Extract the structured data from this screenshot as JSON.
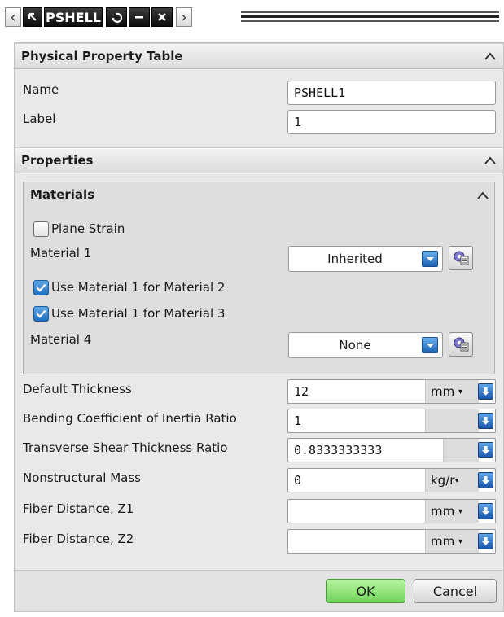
{
  "toolbar": {
    "title": "PSHELL",
    "nav_left_icon": "chevron-left-icon",
    "nav_right_icon": "chevron-right-icon",
    "select_icon": "arrow-select-icon",
    "undo_icon": "undo-icon",
    "minimize_icon": "minimize-icon",
    "close_icon": "close-icon"
  },
  "physical_property_table": {
    "header": "Physical Property Table",
    "name_label": "Name",
    "name_value": "PSHELL1",
    "label_label": "Label",
    "label_value": "1"
  },
  "properties": {
    "header": "Properties",
    "materials": {
      "header": "Materials",
      "plane_strain_label": "Plane Strain",
      "plane_strain_checked": false,
      "material1_label": "Material 1",
      "material1_value": "Inherited",
      "use_mat1_for_mat2_label": "Use Material 1 for Material 2",
      "use_mat1_for_mat2_checked": true,
      "use_mat1_for_mat3_label": "Use Material 1 for Material 3",
      "use_mat1_for_mat3_checked": true,
      "material4_label": "Material 4",
      "material4_value": "None"
    },
    "rows": [
      {
        "label": "Default Thickness",
        "value": "12",
        "unit": "mm"
      },
      {
        "label": "Bending Coefficient of Inertia Ratio",
        "value": "1",
        "unit": ""
      },
      {
        "label": "Transverse Shear Thickness Ratio",
        "value": "0.8333333333",
        "unit": ""
      },
      {
        "label": "Nonstructural Mass",
        "value": "0",
        "unit": "kg/r"
      },
      {
        "label": "Fiber Distance, Z1",
        "value": "",
        "unit": "mm"
      },
      {
        "label": "Fiber Distance, Z2",
        "value": "",
        "unit": "mm"
      }
    ]
  },
  "buttons": {
    "ok": "OK",
    "cancel": "Cancel"
  },
  "colors": {
    "accent_blue": "#1d6fbf",
    "ok_green": "#6fd35a"
  }
}
